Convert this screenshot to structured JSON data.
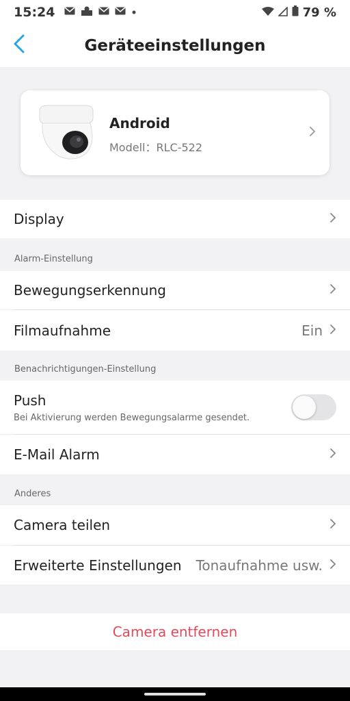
{
  "status_bar": {
    "time": "15:24",
    "battery": "79 %",
    "left_icons": [
      "gmail-icon",
      "notification-icon",
      "gmail-icon",
      "gmail-icon",
      "dot-icon"
    ],
    "right_icons": [
      "wifi-icon",
      "signal-icon",
      "battery-icon"
    ]
  },
  "header": {
    "title": "Geräteeinstellungen"
  },
  "device": {
    "name": "Android",
    "model": "Modell：RLC-522"
  },
  "settings": {
    "display": {
      "label": "Display"
    },
    "alarm_section": "Alarm-Einstellung",
    "motion": {
      "label": "Bewegungserkennung"
    },
    "recording": {
      "label": "Filmaufnahme",
      "value": "Ein"
    },
    "notification_section": "Benachrichtigungen-Einstellung",
    "push": {
      "label": "Push",
      "description": "Bei Aktivierung werden Bewegungsalarme gesendet.",
      "enabled": false
    },
    "email": {
      "label": "E-Mail Alarm"
    },
    "other_section": "Anderes",
    "share": {
      "label": "Camera teilen"
    },
    "advanced": {
      "label": "Erweiterte Einstellungen",
      "value": "Tonaufnahme usw."
    }
  },
  "actions": {
    "remove_label": "Camera entfernen"
  },
  "colors": {
    "accent": "#2aa3e0",
    "danger": "#e24a5a",
    "background": "#f2f2f4"
  }
}
